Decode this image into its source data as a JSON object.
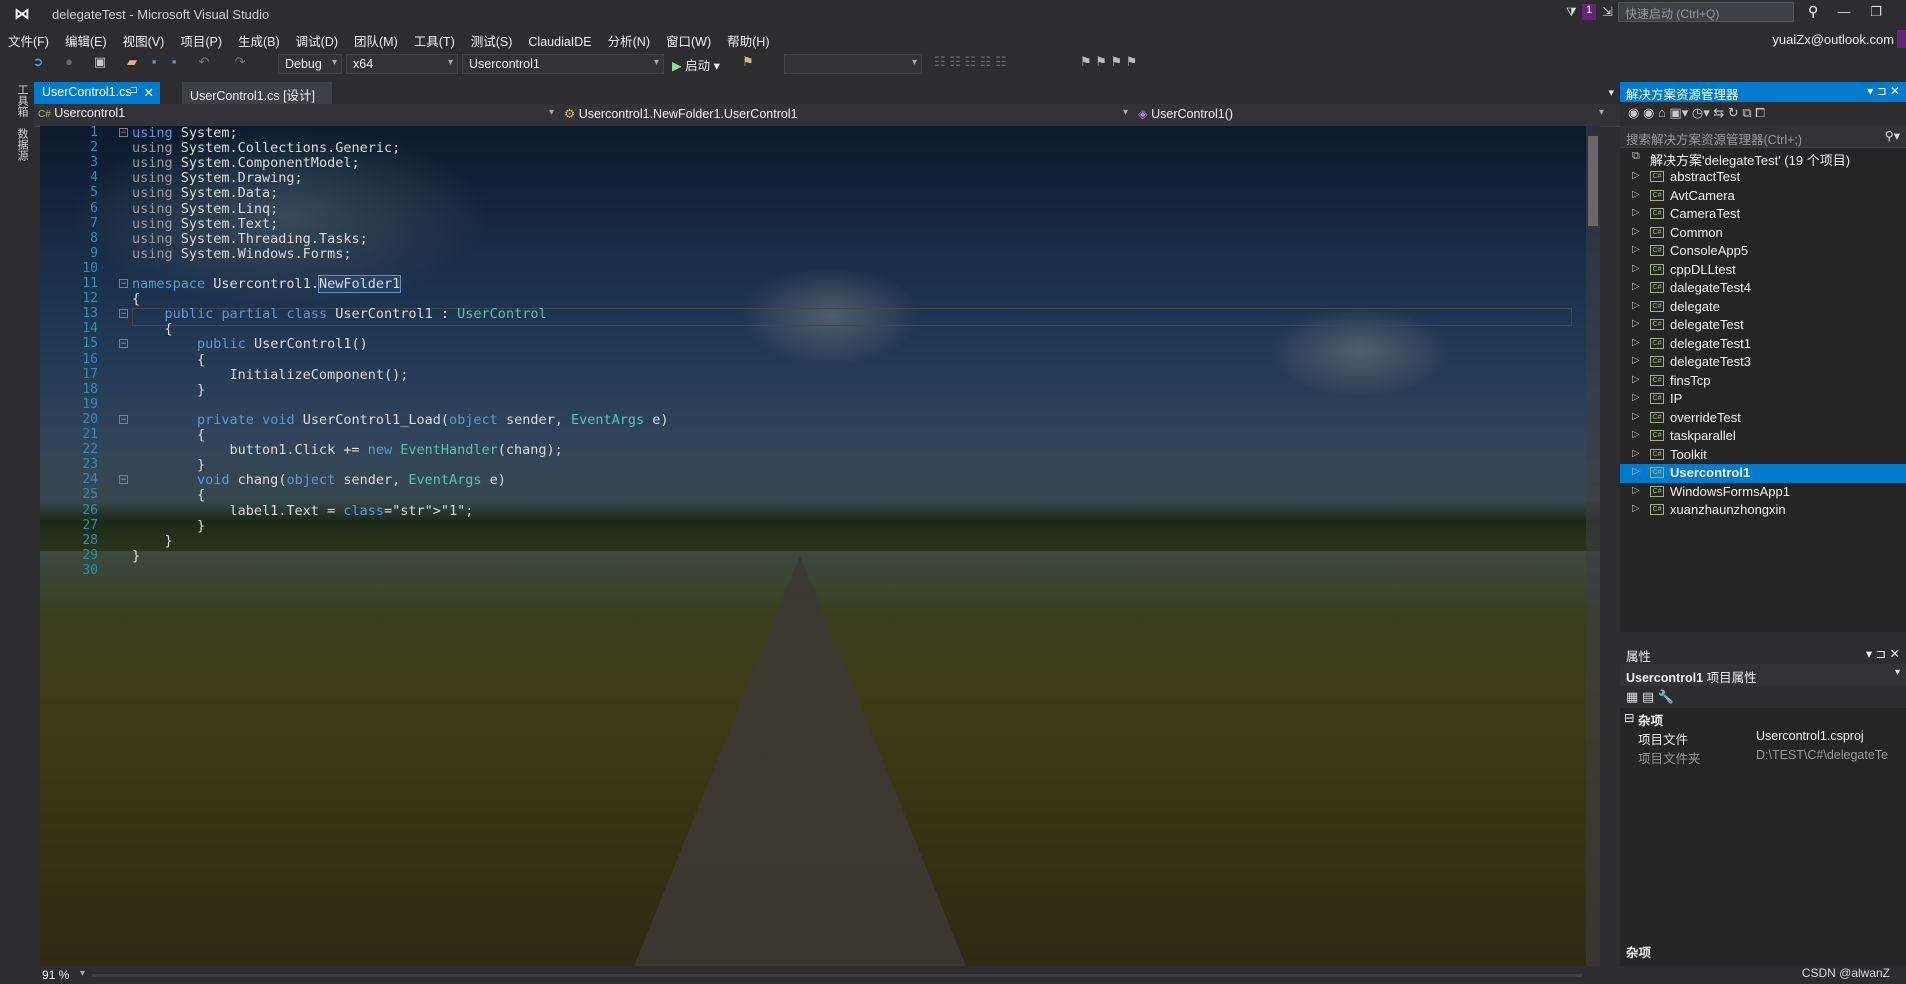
{
  "window": {
    "title": "delegateTest - Microsoft Visual Studio",
    "quick_launch_placeholder": "快速启动 (Ctrl+Q)",
    "notification_count": "1",
    "account": "yuaiZx@outlook.com"
  },
  "menu": [
    "文件(F)",
    "编辑(E)",
    "视图(V)",
    "项目(P)",
    "生成(B)",
    "调试(D)",
    "团队(M)",
    "工具(T)",
    "测试(S)",
    "ClaudiaIDE",
    "分析(N)",
    "窗口(W)",
    "帮助(H)"
  ],
  "toolbar": {
    "config": "Debug",
    "platform": "x64",
    "startup_project": "Usercontrol1",
    "start_label": "启动"
  },
  "left_strip": [
    "工具箱",
    "数据源"
  ],
  "doc_tabs": [
    {
      "label": "UserControl1.cs",
      "active": true
    },
    {
      "label": "UserControl1.cs [设计]",
      "active": false
    }
  ],
  "navbar": {
    "project": "Usercontrol1",
    "type": "Usercontrol1.NewFolder1.UserControl1",
    "member": "UserControl1()"
  },
  "editor": {
    "zoom": "91 %",
    "line_numbers": [
      "1",
      "2",
      "3",
      "4",
      "5",
      "6",
      "7",
      "8",
      "9",
      "10",
      "11",
      "12",
      "13",
      "14",
      "15",
      "16",
      "17",
      "18",
      "19",
      "20",
      "21",
      "22",
      "23",
      "24",
      "25",
      "26",
      "27",
      "28",
      "29",
      "30"
    ],
    "lines": [
      "using System;",
      "using System.Collections.Generic;",
      "using System.ComponentModel;",
      "using System.Drawing;",
      "using System.Data;",
      "using System.Linq;",
      "using System.Text;",
      "using System.Threading.Tasks;",
      "using System.Windows.Forms;",
      "",
      "namespace Usercontrol1.NewFolder1",
      "{",
      "    public partial class UserControl1 : UserControl",
      "    {",
      "        public UserControl1()",
      "        {",
      "            InitializeComponent();",
      "        }",
      "",
      "        private void UserControl1_Load(object sender, EventArgs e)",
      "        {",
      "            button1.Click += new EventHandler(chang);",
      "        }",
      "        void chang(object sender, EventArgs e)",
      "        {",
      "            label1.Text = \"1\";",
      "        }",
      "    }",
      "}",
      ""
    ]
  },
  "solution_explorer": {
    "title": "解决方案资源管理器",
    "search_placeholder": "搜索解决方案资源管理器(Ctrl+;)",
    "root": "解决方案'delegateTest' (19 个项目)",
    "projects": [
      "abstractTest",
      "AvtCamera",
      "CameraTest",
      "Common",
      "ConsoleApp5",
      "cppDLLtest",
      "dalegateTest4",
      "delegate",
      "delegateTest",
      "delegateTest1",
      "delegateTest3",
      "finsTcp",
      "IP",
      "overrideTest",
      "taskparallel",
      "Toolkit",
      "Usercontrol1",
      "WindowsFormsApp1",
      "xuanzhaunzhongxin"
    ],
    "selected": "Usercontrol1"
  },
  "properties": {
    "title": "属性",
    "object": "Usercontrol1",
    "object_kind": "项目属性",
    "category": "杂项",
    "rows": [
      {
        "key": "项目文件",
        "value": "Usercontrol1.csproj"
      },
      {
        "key": "项目文件夹",
        "value": "D:\\TEST\\C#\\delegateTe"
      }
    ],
    "description_title": "杂项"
  },
  "watermark": "CSDN @alwanZ"
}
